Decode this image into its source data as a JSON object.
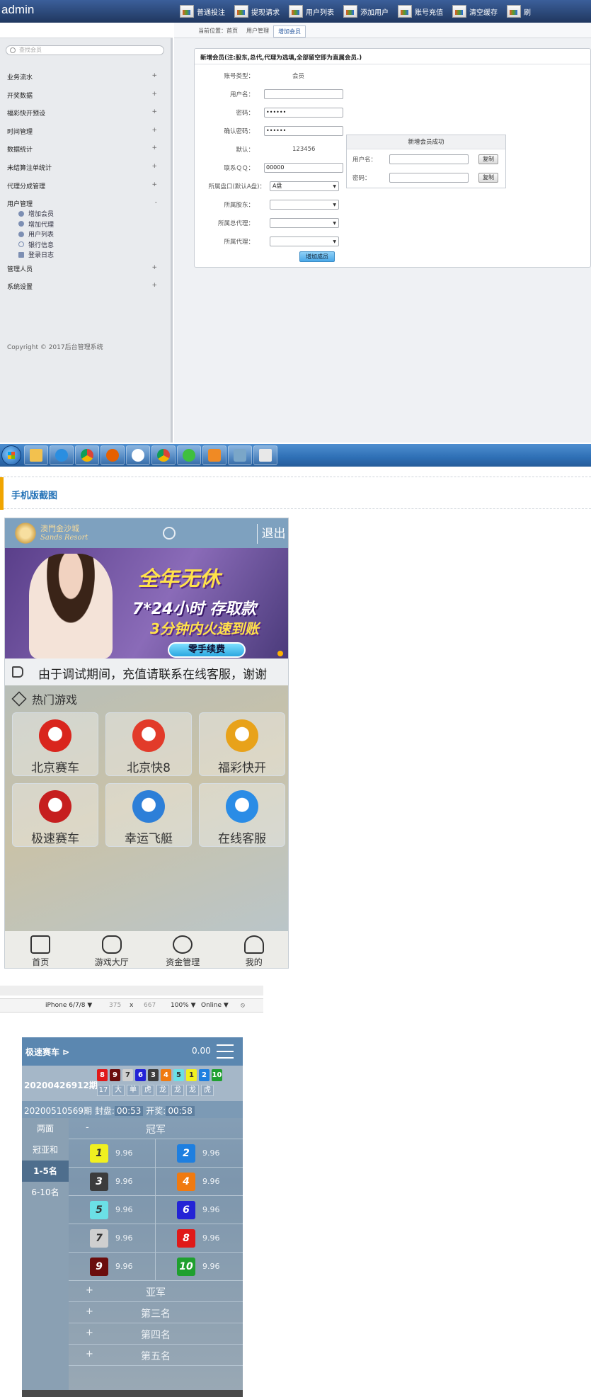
{
  "admin": {
    "title": "admin",
    "topnav": [
      "普通投注",
      "提现请求",
      "用户列表",
      "添加用户",
      "账号充值",
      "清空缓存",
      "刷"
    ],
    "search_placeholder": "查找会员",
    "menu": [
      {
        "label": "业务流水",
        "sign": "+"
      },
      {
        "label": "开奖数据",
        "sign": "+"
      },
      {
        "label": "福彩快开预设",
        "sign": "+"
      },
      {
        "label": "时间管理",
        "sign": "+"
      },
      {
        "label": "数据统计",
        "sign": "+"
      },
      {
        "label": "未结算注单统计",
        "sign": "+"
      },
      {
        "label": "代理分成管理",
        "sign": "+"
      },
      {
        "label": "用户管理",
        "sign": "-"
      }
    ],
    "submenu": [
      "增加会员",
      "增加代理",
      "用户列表",
      "银行信息",
      "登录日志"
    ],
    "menu_after": [
      {
        "label": "管理人员",
        "sign": "+"
      },
      {
        "label": "系统设置",
        "sign": "+"
      }
    ],
    "copyright": "Copyright © 2017后台管理系统",
    "breadcrumb": {
      "prefix": "当前位置：首页",
      "level2": "用户管理",
      "current": "增加会员"
    },
    "form": {
      "title": "新增会员(注:股东,总代,代理为选填,全部留空即为直属会员.)",
      "account_type_label": "账号类型：",
      "account_type_value": "会员",
      "username_label": "用户名：",
      "password_label": "密码：",
      "password_value": "••••••",
      "confirm_label": "确认密码：",
      "confirm_value": "••••••",
      "default_label": "默认：",
      "default_value": "123456",
      "qq_label": "联系ＱＱ：",
      "qq_value": "00000",
      "plate_label": "所属盘口(默认A盘)：",
      "plate_value": "A盘",
      "shareholder_label": "所属股东：",
      "general_agent_label": "所属总代理：",
      "agent_label": "所属代理：",
      "submit": "增加成员"
    },
    "success": {
      "title": "新增会员成功",
      "username_label": "用户名：",
      "password_label": "密码：",
      "copy": "复制"
    }
  },
  "section_title": "手机版截图",
  "mobile_home": {
    "logo_cn": "澳門金沙城",
    "logo_en": "Sands Resort",
    "logout": "退出",
    "banner": {
      "line1": "全年无休",
      "line2": "7*24小时 存取款",
      "line3": "3分钟内火速到账",
      "button": "零手续费"
    },
    "notice": "由于调试期间，充值请联系在线客服，谢谢",
    "hot_title": "热门游戏",
    "games": [
      {
        "name": "北京赛车",
        "color": "#d9251d"
      },
      {
        "name": "北京快8",
        "color": "#e23b2a"
      },
      {
        "name": "福彩快开",
        "color": "#e8a21a"
      },
      {
        "name": "极速赛车",
        "color": "#c61f1f"
      },
      {
        "name": "幸运飞艇",
        "color": "#2d7fd8"
      },
      {
        "name": "在线客服",
        "color": "#2a8ce6"
      }
    ],
    "tabs": [
      "首页",
      "游戏大厅",
      "资金管理",
      "我的"
    ]
  },
  "devtools": {
    "device": "iPhone 6/7/8 ▼",
    "width": "375",
    "x": "x",
    "height": "667",
    "zoom": "100% ▼",
    "network": "Online ▼"
  },
  "game": {
    "title": "极速赛车",
    "balance": "0.00",
    "prev_issue": "20200426912期",
    "balls": [
      {
        "n": "8",
        "c": "#e01919"
      },
      {
        "n": "9",
        "c": "#6b0d0d"
      },
      {
        "n": "7",
        "c": "#cfcfcf"
      },
      {
        "n": "6",
        "c": "#2323d6"
      },
      {
        "n": "3",
        "c": "#3c3c3c"
      },
      {
        "n": "4",
        "c": "#f07a10"
      },
      {
        "n": "5",
        "c": "#6be0e6"
      },
      {
        "n": "1",
        "c": "#f0f020"
      },
      {
        "n": "2",
        "c": "#1e7fe0"
      },
      {
        "n": "10",
        "c": "#1fa02f"
      }
    ],
    "attrs": [
      "17",
      "大",
      "单",
      "虎",
      "龙",
      "龙",
      "龙",
      "虎"
    ],
    "timer": {
      "issue": "20200510569期",
      "close_label": "封盘:",
      "close_time": "00:53",
      "open_label": "开奖:",
      "open_time": "00:58"
    },
    "side": [
      "两面",
      "冠亚和",
      "1-5名",
      "6-10名"
    ],
    "first_section": {
      "sign": "-",
      "name": "冠军"
    },
    "odds": [
      {
        "n": "1",
        "c": "#f0f020",
        "o": "9.96"
      },
      {
        "n": "2",
        "c": "#1e7fe0",
        "o": "9.96"
      },
      {
        "n": "3",
        "c": "#3c3c3c",
        "o": "9.96"
      },
      {
        "n": "4",
        "c": "#f07a10",
        "o": "9.96"
      },
      {
        "n": "5",
        "c": "#6be0e6",
        "o": "9.96"
      },
      {
        "n": "6",
        "c": "#2323d6",
        "o": "9.96"
      },
      {
        "n": "7",
        "c": "#cfcfcf",
        "o": "9.96"
      },
      {
        "n": "8",
        "c": "#e01919",
        "o": "9.96"
      },
      {
        "n": "9",
        "c": "#6b0d0d",
        "o": "9.96"
      },
      {
        "n": "10",
        "c": "#1fa02f",
        "o": "9.96"
      }
    ],
    "sections": [
      {
        "sign": "+",
        "name": "亚军"
      },
      {
        "sign": "+",
        "name": "第三名"
      },
      {
        "sign": "+",
        "name": "第四名"
      },
      {
        "sign": "+",
        "name": "第五名"
      }
    ]
  }
}
